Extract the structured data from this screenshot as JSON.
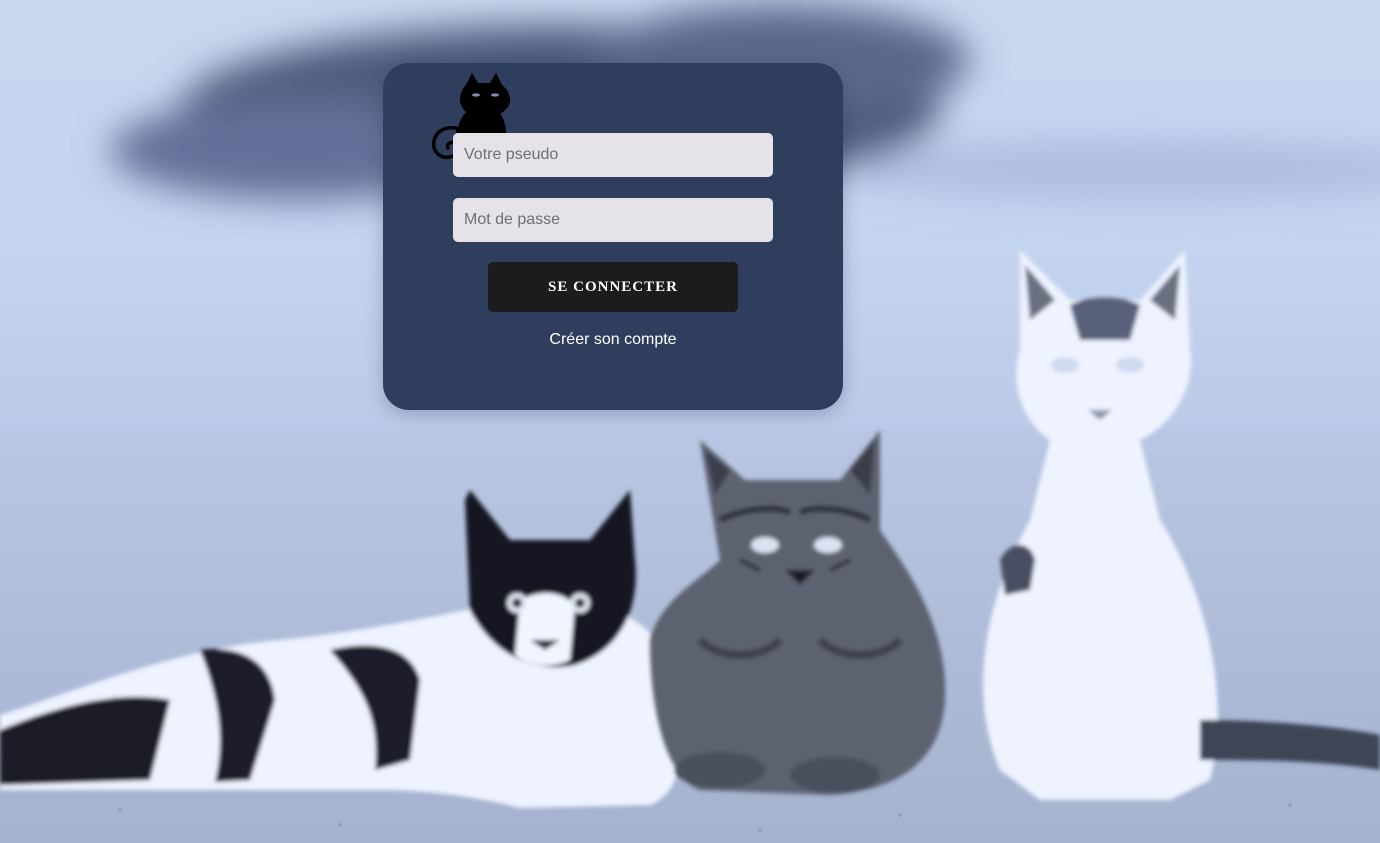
{
  "login": {
    "username_placeholder": "Votre pseudo",
    "password_placeholder": "Mot de passe",
    "submit_label": "SE CONNECTER",
    "create_account_label": "Créer son compte"
  },
  "theme": {
    "card_color": "#2e3e5c",
    "button_color": "#1c1b1d",
    "input_color": "#e6e3e8",
    "background_tint": "#c4d3ef"
  },
  "icons": {
    "logo": "black-cat-icon"
  },
  "background": {
    "subject": "three cats photo"
  }
}
